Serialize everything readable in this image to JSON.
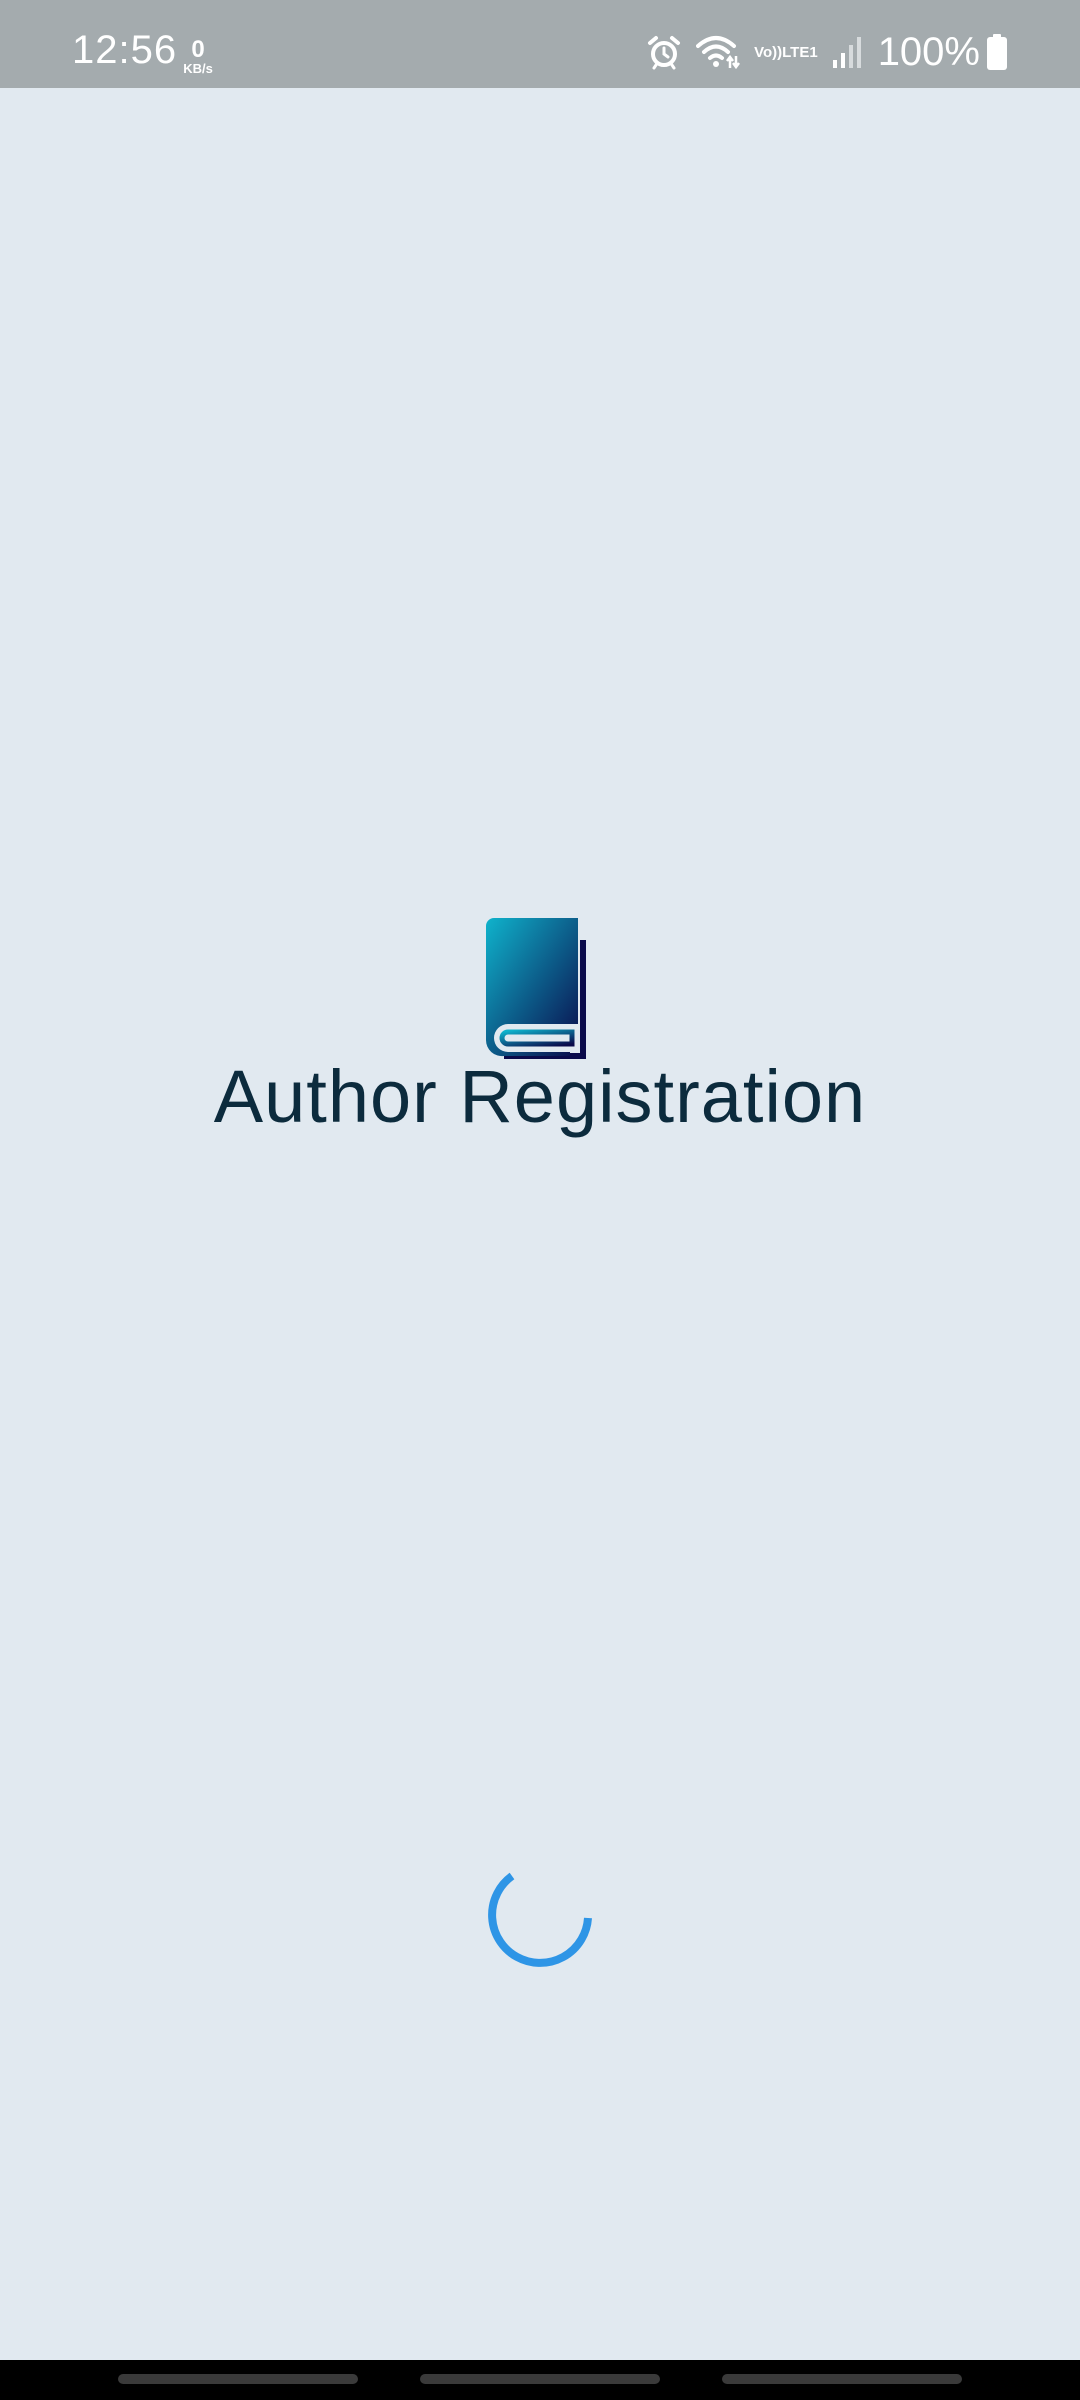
{
  "status_bar": {
    "time": "12:56",
    "net_speed_value": "0",
    "net_speed_unit": "KB/s",
    "volte_top": "Vo))",
    "volte_bottom": "LTE1",
    "battery_percent": "100%",
    "icons": [
      "alarm-icon",
      "wifi-icon",
      "volte-icon",
      "signal-icon",
      "battery-icon"
    ]
  },
  "splash": {
    "logo_icon": "book-icon",
    "title": "Author Registration",
    "loading_indicator": "spinner-icon"
  },
  "colors": {
    "background": "#e1e9f0",
    "status_bar": "#a4abae",
    "title": "#0c2b3d",
    "logo_gradient_start": "#0fb3cc",
    "logo_gradient_end": "#0a0a4a",
    "spinner": "#2e95e6"
  }
}
